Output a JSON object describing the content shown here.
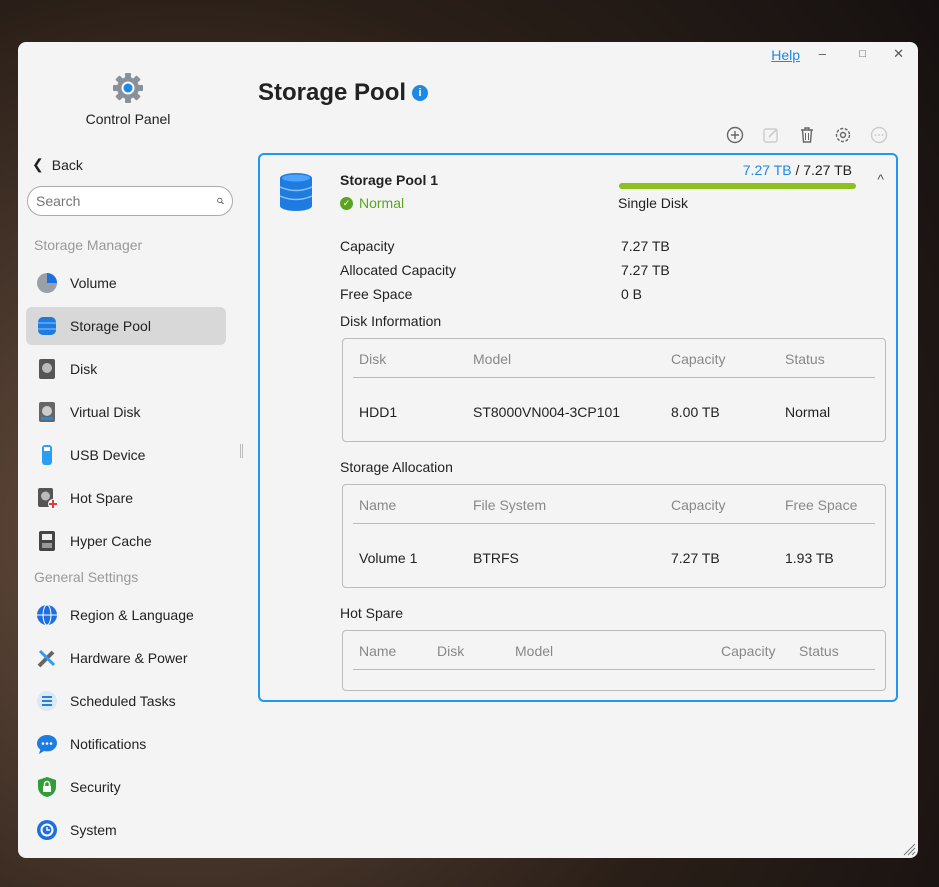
{
  "sidebar": {
    "title": "Control Panel",
    "back": "Back",
    "search_placeholder": "Search",
    "sections": [
      {
        "label": "Storage Manager",
        "items": [
          {
            "label": "Volume",
            "icon": "pie-chart-icon"
          },
          {
            "label": "Storage Pool",
            "icon": "database-icon",
            "active": true
          },
          {
            "label": "Disk",
            "icon": "hard-disk-icon"
          },
          {
            "label": "Virtual Disk",
            "icon": "virtual-disk-icon"
          },
          {
            "label": "USB Device",
            "icon": "usb-icon"
          },
          {
            "label": "Hot Spare",
            "icon": "hot-spare-icon"
          },
          {
            "label": "Hyper Cache",
            "icon": "ssd-cache-icon"
          }
        ]
      },
      {
        "label": "General Settings",
        "items": [
          {
            "label": "Region & Language",
            "icon": "globe-icon"
          },
          {
            "label": "Hardware & Power",
            "icon": "tools-icon"
          },
          {
            "label": "Scheduled Tasks",
            "icon": "tasks-icon"
          },
          {
            "label": "Notifications",
            "icon": "chat-icon"
          },
          {
            "label": "Security",
            "icon": "shield-lock-icon"
          },
          {
            "label": "System",
            "icon": "system-icon"
          }
        ]
      }
    ]
  },
  "window": {
    "help": "Help"
  },
  "page": {
    "title": "Storage Pool"
  },
  "pool": {
    "name": "Storage Pool 1",
    "status": "Normal",
    "used": "7.27 TB",
    "total": "7.27 TB",
    "separator": "/",
    "usage_fraction": 1.0,
    "type": "Single Disk",
    "details": [
      {
        "k": "Capacity",
        "v": "7.27 TB"
      },
      {
        "k": "Allocated Capacity",
        "v": "7.27 TB"
      },
      {
        "k": "Free Space",
        "v": "0 B"
      }
    ],
    "disk_info": {
      "label": "Disk Information",
      "headers": [
        "Disk",
        "Model",
        "Capacity",
        "Status"
      ],
      "rows": [
        [
          "HDD1",
          "ST8000VN004-3CP101",
          "8.00 TB",
          "Normal"
        ]
      ]
    },
    "allocation": {
      "label": "Storage Allocation",
      "headers": [
        "Name",
        "File System",
        "Capacity",
        "Free Space"
      ],
      "rows": [
        [
          "Volume 1",
          "BTRFS",
          "7.27 TB",
          "1.93 TB"
        ]
      ]
    },
    "hot_spare": {
      "label": "Hot Spare",
      "headers": [
        "Name",
        "Disk",
        "Model",
        "Capacity",
        "Status"
      ],
      "rows": []
    }
  },
  "colors": {
    "accent": "#2196f3",
    "bar": "#8bc01e",
    "normal": "#5aa51f"
  }
}
